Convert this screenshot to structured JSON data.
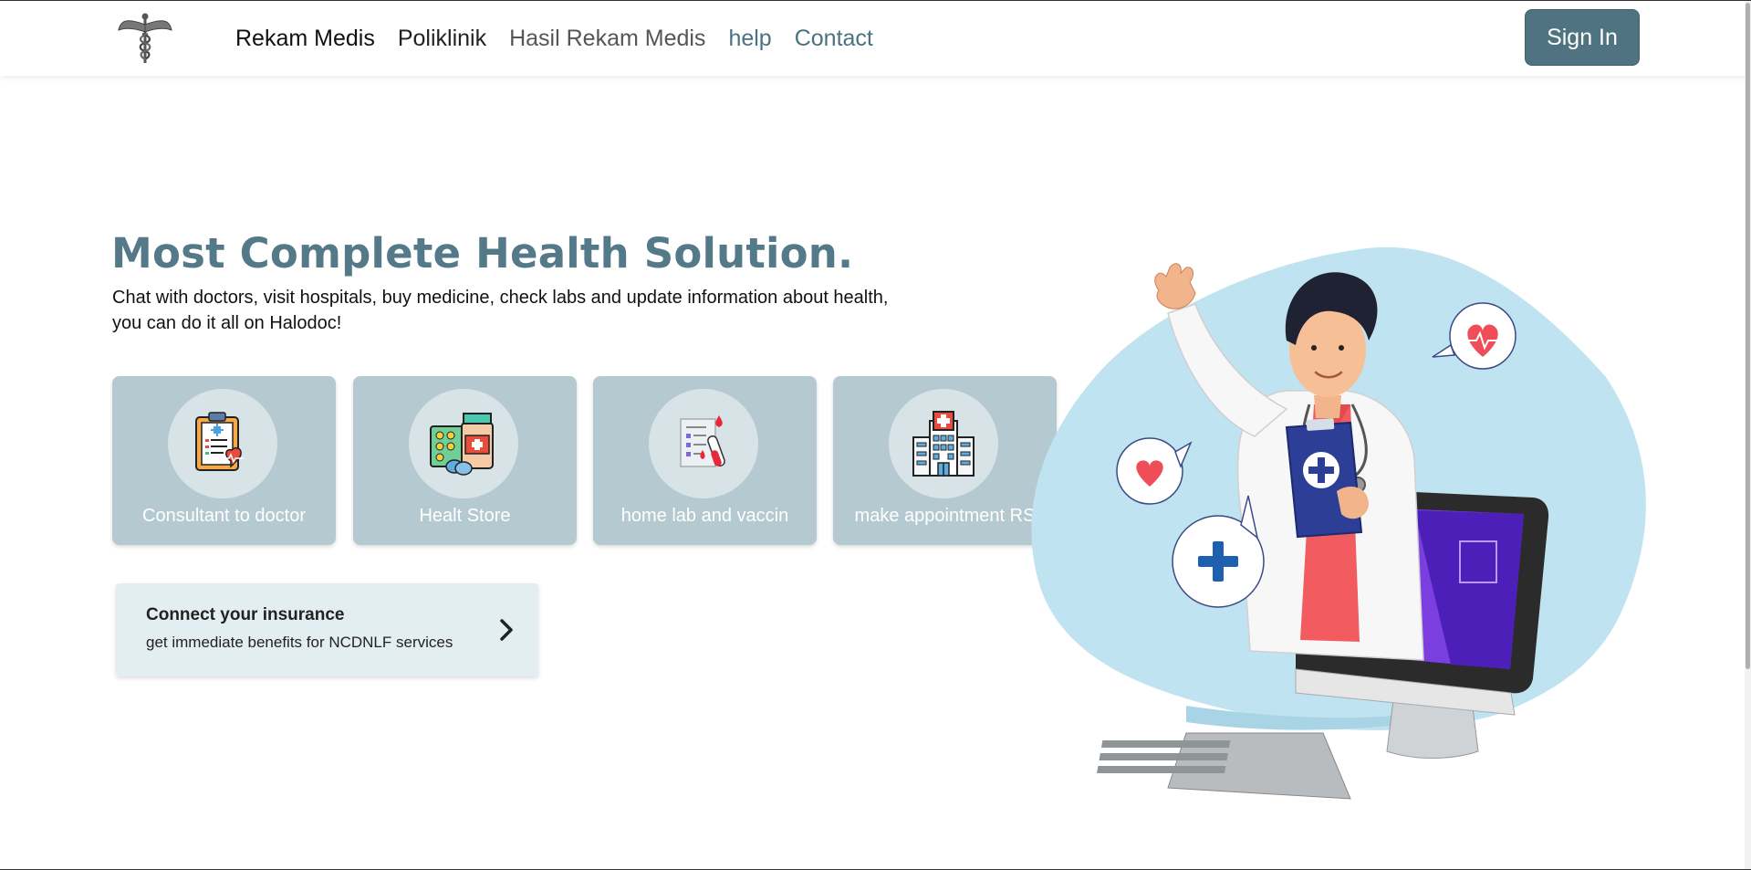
{
  "nav": {
    "items": [
      {
        "label": "Rekam Medis"
      },
      {
        "label": "Poliklinik"
      },
      {
        "label": "Hasil Rekam Medis"
      },
      {
        "label": "help"
      },
      {
        "label": "Contact"
      }
    ],
    "signin_label": "Sign In",
    "logo_icon": "caduceus-icon"
  },
  "hero": {
    "title": "Most Complete Health Solution.",
    "description": "Chat with doctors, visit hospitals, buy medicine, check labs and update information about health, you can do it all on Halodoc!"
  },
  "services": [
    {
      "label": "Consultant to doctor",
      "icon": "medical-clipboard-icon"
    },
    {
      "label": "Healt Store",
      "icon": "medicine-store-icon"
    },
    {
      "label": "home lab and vaccin",
      "icon": "lab-test-icon"
    },
    {
      "label": "make appointment RS",
      "icon": "hospital-icon"
    }
  ],
  "insurance": {
    "title": "Connect your insurance",
    "subtitle": "get immediate benefits for NCDNLF services"
  },
  "illustration": "doctor-on-computer-illustration",
  "colors": {
    "accent": "#4f7380",
    "title": "#547988",
    "card_bg": "#b5c9d0",
    "insurance_bg": "#e3eef3",
    "blob": "#bfe3f0"
  }
}
